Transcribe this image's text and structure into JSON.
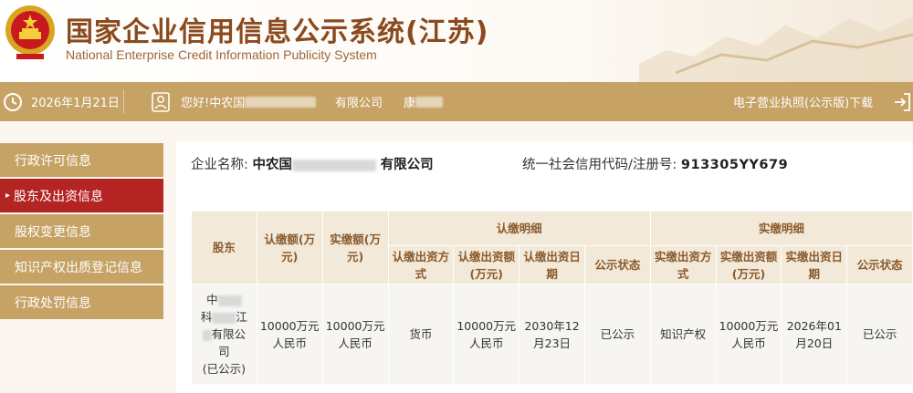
{
  "header": {
    "title": "国家企业信用信息公示系统(江苏)",
    "subtitle": "National Enterprise Credit Information Publicity System"
  },
  "infobar": {
    "date": "2026年1月21日",
    "greeting_prefix": "您好!中农国",
    "company_suffix": "有限公司",
    "user_name_prefix": "康",
    "download_label": "电子营业执照(公示版)下载"
  },
  "menu": {
    "items": [
      {
        "label": "行政许可信息"
      },
      {
        "label": "股东及出资信息"
      },
      {
        "label": "股权变更信息"
      },
      {
        "label": "知识产权出质登记信息"
      },
      {
        "label": "行政处罚信息"
      }
    ]
  },
  "company": {
    "name_label": "企业名称:",
    "name_prefix": "中农国",
    "name_suffix": "有限公司",
    "credit_label": "统一社会信用代码/注册号:",
    "credit_prefix": "913305",
    "credit_suffix": "YY679"
  },
  "table": {
    "headers": {
      "shareholder": "股东",
      "subscribed_amount": "认缴额(万元)",
      "paid_amount": "实缴额(万元)",
      "subscribed_detail": "认缴明细",
      "paid_detail": "实缴明细",
      "sub_method": "认缴出资方式",
      "sub_amount": "认缴出资额(万元)",
      "sub_date": "认缴出资日期",
      "sub_status": "公示状态",
      "paid_method": "实缴出资方式",
      "paid_amount_detail": "实缴出资额(万元)",
      "paid_date": "实缴出资日期",
      "paid_status": "公示状态"
    },
    "rows": [
      {
        "shareholder_l1": "中",
        "shareholder_l2": "科",
        "shareholder_l2b": "江",
        "shareholder_l3": "有限公",
        "shareholder_l4": "司",
        "shareholder_l5": "(已公示)",
        "subscribed_amount": "10000万元人民币",
        "paid_amount": "10000万元人民币",
        "sub_method": "货币",
        "sub_amount": "10000万元人民币",
        "sub_date": "2030年12月23日",
        "sub_status": "已公示",
        "paid_method": "知识产权",
        "paid_amount_detail": "10000万元人民币",
        "paid_date": "2026年01月20日",
        "paid_status": "已公示"
      }
    ]
  },
  "colors": {
    "gold": "#c6a264",
    "active_red": "#b32422",
    "title_brown": "#8b4a1d",
    "header_cell": "#f2e9d9"
  }
}
